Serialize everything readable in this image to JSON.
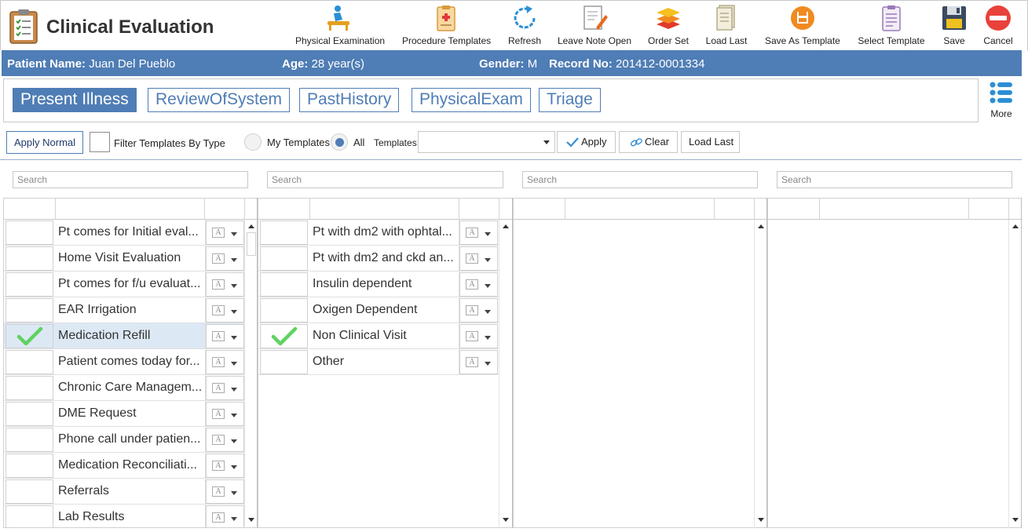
{
  "app": {
    "title": "Clinical Evaluation"
  },
  "toolbar": [
    {
      "label": "Physical Examination",
      "icon": "physical-exam-icon"
    },
    {
      "label": "Procedure Templates",
      "icon": "procedure-templates-icon"
    },
    {
      "label": "Refresh",
      "icon": "refresh-icon"
    },
    {
      "label": "Leave Note Open",
      "icon": "leave-note-open-icon"
    },
    {
      "label": "Order Set",
      "icon": "order-set-icon"
    },
    {
      "label": "Load Last",
      "icon": "load-last-icon"
    },
    {
      "label": "Save As Template",
      "icon": "save-as-template-icon"
    },
    {
      "label": "Select Template",
      "icon": "select-template-icon"
    },
    {
      "label": "Save",
      "icon": "save-icon"
    },
    {
      "label": "Cancel",
      "icon": "cancel-icon"
    }
  ],
  "patient": {
    "name_label": "Patient Name:",
    "name": "Juan Del Pueblo",
    "age_label": "Age:",
    "age": "28 year(s)",
    "gender_label": "Gender:",
    "gender": "M",
    "record_label": "Record No:",
    "record": "201412-0001334"
  },
  "tabs": [
    "Present Illness",
    "ReviewOfSystem",
    "PastHistory",
    "PhysicalExam",
    "Triage"
  ],
  "more_label": "More",
  "filter": {
    "apply_normal": "Apply Normal",
    "filter_by_type": "Filter Templates By Type",
    "my_templates": "My Templates",
    "all": "All",
    "templates_label": "Templates:",
    "templates_value": "",
    "apply": "Apply",
    "clear": "Clear",
    "load_last": "Load Last"
  },
  "search_placeholder": "Search",
  "lists": {
    "col1": [
      {
        "text": "Pt comes for Initial eval...",
        "checked": false
      },
      {
        "text": "Home Visit Evaluation",
        "checked": false
      },
      {
        "text": "Pt comes for f/u evaluat...",
        "checked": false
      },
      {
        "text": "EAR Irrigation",
        "checked": false
      },
      {
        "text": "Medication Refill",
        "checked": true
      },
      {
        "text": "Patient comes today for...",
        "checked": false
      },
      {
        "text": "Chronic Care Managem...",
        "checked": false
      },
      {
        "text": "DME Request",
        "checked": false
      },
      {
        "text": "Phone call under patien...",
        "checked": false
      },
      {
        "text": "Medication Reconciliati...",
        "checked": false
      },
      {
        "text": "Referrals",
        "checked": false
      },
      {
        "text": "Lab Results",
        "checked": false
      }
    ],
    "col2": [
      {
        "text": "Pt with dm2 with ophtal...",
        "checked": false
      },
      {
        "text": "Pt with dm2 and ckd an...",
        "checked": false
      },
      {
        "text": "Insulin dependent",
        "checked": false
      },
      {
        "text": "Oxigen Dependent",
        "checked": false
      },
      {
        "text": "Non Clinical Visit",
        "checked": true
      },
      {
        "text": "Other",
        "checked": false
      }
    ]
  },
  "colors": {
    "accent": "#4f7db5",
    "check": "#5fd35f",
    "selected_row": "#dde8f5"
  }
}
